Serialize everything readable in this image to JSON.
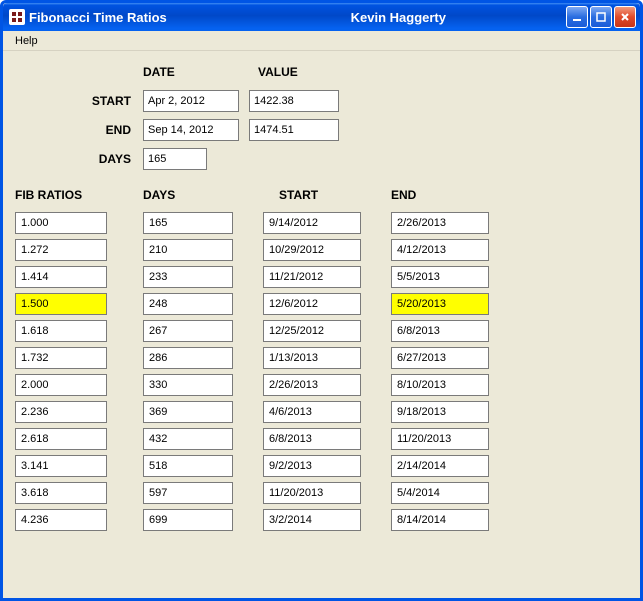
{
  "window": {
    "title": "Fibonacci Time Ratios",
    "author": "Kevin Haggerty"
  },
  "menubar": {
    "help": "Help"
  },
  "header": {
    "date_label": "DATE",
    "value_label": "VALUE",
    "start_label": "START",
    "end_label": "END",
    "days_label": "DAYS",
    "start_date": "Apr 2, 2012",
    "start_value": "1422.38",
    "end_date": "Sep 14, 2012",
    "end_value": "1474.51",
    "days_value": "165"
  },
  "table": {
    "head_fib": "FIB RATIOS",
    "head_days": "DAYS",
    "head_start": "START",
    "head_end": "END",
    "rows": [
      {
        "fib": "1.000",
        "days": "165",
        "start": "9/14/2012",
        "end": "2/26/2013",
        "hl_fib": false,
        "hl_end": false
      },
      {
        "fib": "1.272",
        "days": "210",
        "start": "10/29/2012",
        "end": "4/12/2013",
        "hl_fib": false,
        "hl_end": false
      },
      {
        "fib": "1.414",
        "days": "233",
        "start": "11/21/2012",
        "end": "5/5/2013",
        "hl_fib": false,
        "hl_end": false
      },
      {
        "fib": "1.500",
        "days": "248",
        "start": "12/6/2012",
        "end": "5/20/2013",
        "hl_fib": true,
        "hl_end": true
      },
      {
        "fib": "1.618",
        "days": "267",
        "start": "12/25/2012",
        "end": "6/8/2013",
        "hl_fib": false,
        "hl_end": false
      },
      {
        "fib": "1.732",
        "days": "286",
        "start": "1/13/2013",
        "end": "6/27/2013",
        "hl_fib": false,
        "hl_end": false
      },
      {
        "fib": "2.000",
        "days": "330",
        "start": "2/26/2013",
        "end": "8/10/2013",
        "hl_fib": false,
        "hl_end": false
      },
      {
        "fib": "2.236",
        "days": "369",
        "start": "4/6/2013",
        "end": "9/18/2013",
        "hl_fib": false,
        "hl_end": false
      },
      {
        "fib": "2.618",
        "days": "432",
        "start": "6/8/2013",
        "end": "11/20/2013",
        "hl_fib": false,
        "hl_end": false
      },
      {
        "fib": "3.141",
        "days": "518",
        "start": "9/2/2013",
        "end": "2/14/2014",
        "hl_fib": false,
        "hl_end": false
      },
      {
        "fib": "3.618",
        "days": "597",
        "start": "11/20/2013",
        "end": "5/4/2014",
        "hl_fib": false,
        "hl_end": false
      },
      {
        "fib": "4.236",
        "days": "699",
        "start": "3/2/2014",
        "end": "8/14/2014",
        "hl_fib": false,
        "hl_end": false
      }
    ]
  }
}
